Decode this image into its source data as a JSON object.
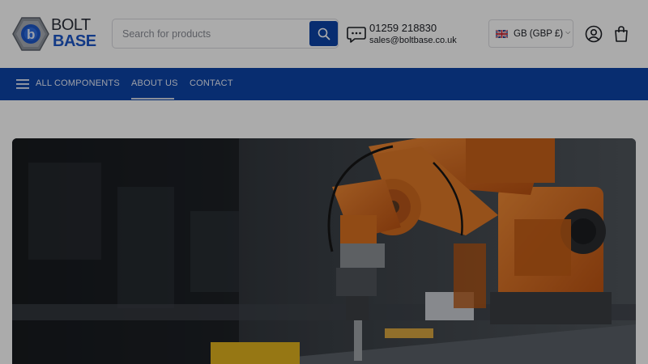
{
  "brand": {
    "line1": "BOLT",
    "line2": "BASE"
  },
  "search": {
    "placeholder": "Search for products",
    "value": ""
  },
  "contact": {
    "phone": "01259 218830",
    "email": "sales@boltbase.co.uk"
  },
  "currency": {
    "label": "GB (GBP £)"
  },
  "nav": {
    "items": [
      {
        "label": "ALL COMPONENTS"
      },
      {
        "label": "ABOUT US"
      },
      {
        "label": "CONTACT"
      }
    ],
    "active": "ABOUT US"
  },
  "colors": {
    "brand_blue": "#0d43a8",
    "logo_blue": "#1d57c8",
    "hero_robot_orange": "#e06a1e"
  },
  "icons": [
    "hex-bolt-logo-icon",
    "search-icon",
    "chat-icon",
    "uk-flag-icon",
    "chevron-down-icon",
    "account-icon",
    "shopping-bag-icon",
    "hamburger-menu-icon"
  ],
  "hero": {
    "image": "industrial robot arm in factory"
  }
}
